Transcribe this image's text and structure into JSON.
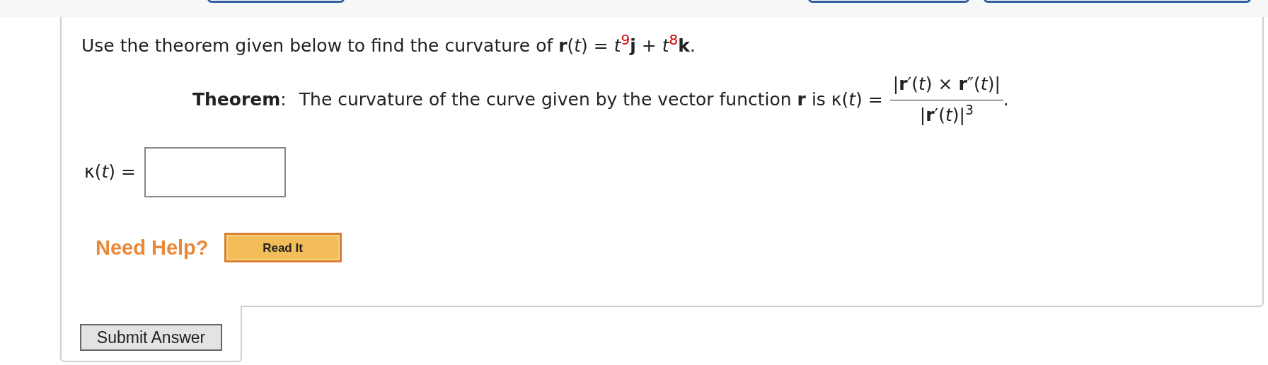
{
  "question": {
    "text": "Use the theorem given below to find the curvature of **r**(*t*) = *t*$^{9}$**j** + *t*$^{8}$**k**."
  },
  "theorem": {
    "label": "Theorem",
    "colon": ":",
    "statement": "The curvature of the curve given by the vector function **r** is κ(*t*) =",
    "numerator": "|**r**′(*t*) × **r**″(*t*)|",
    "denominator": "|**r**′(*t*)|$^{3}$",
    "period": "."
  },
  "answer": {
    "label": "κ(*t*) ="
  },
  "help": {
    "label": "Need Help?",
    "button": "Read It"
  },
  "submit": {
    "label": "Submit Answer"
  }
}
